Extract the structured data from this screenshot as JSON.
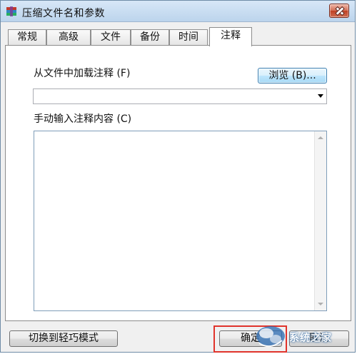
{
  "window": {
    "title": "压缩文件名和参数"
  },
  "tabs": [
    {
      "label": "常规"
    },
    {
      "label": "高级"
    },
    {
      "label": "文件"
    },
    {
      "label": "备份"
    },
    {
      "label": "时间"
    },
    {
      "label": "注释"
    }
  ],
  "comment": {
    "load_label": "从文件中加载注释 (F)",
    "browse_label": "浏览 (B)...",
    "combo_value": "",
    "manual_label": "手动输入注释内容 (C)",
    "text_value": ""
  },
  "buttons": {
    "easy_mode": "切换到轻巧模式",
    "ok": "确定",
    "cancel": "取消"
  },
  "watermark": {
    "text": "系统之家"
  },
  "colors": {
    "highlight": "#e0332b",
    "accent": "#3c7fb1"
  }
}
